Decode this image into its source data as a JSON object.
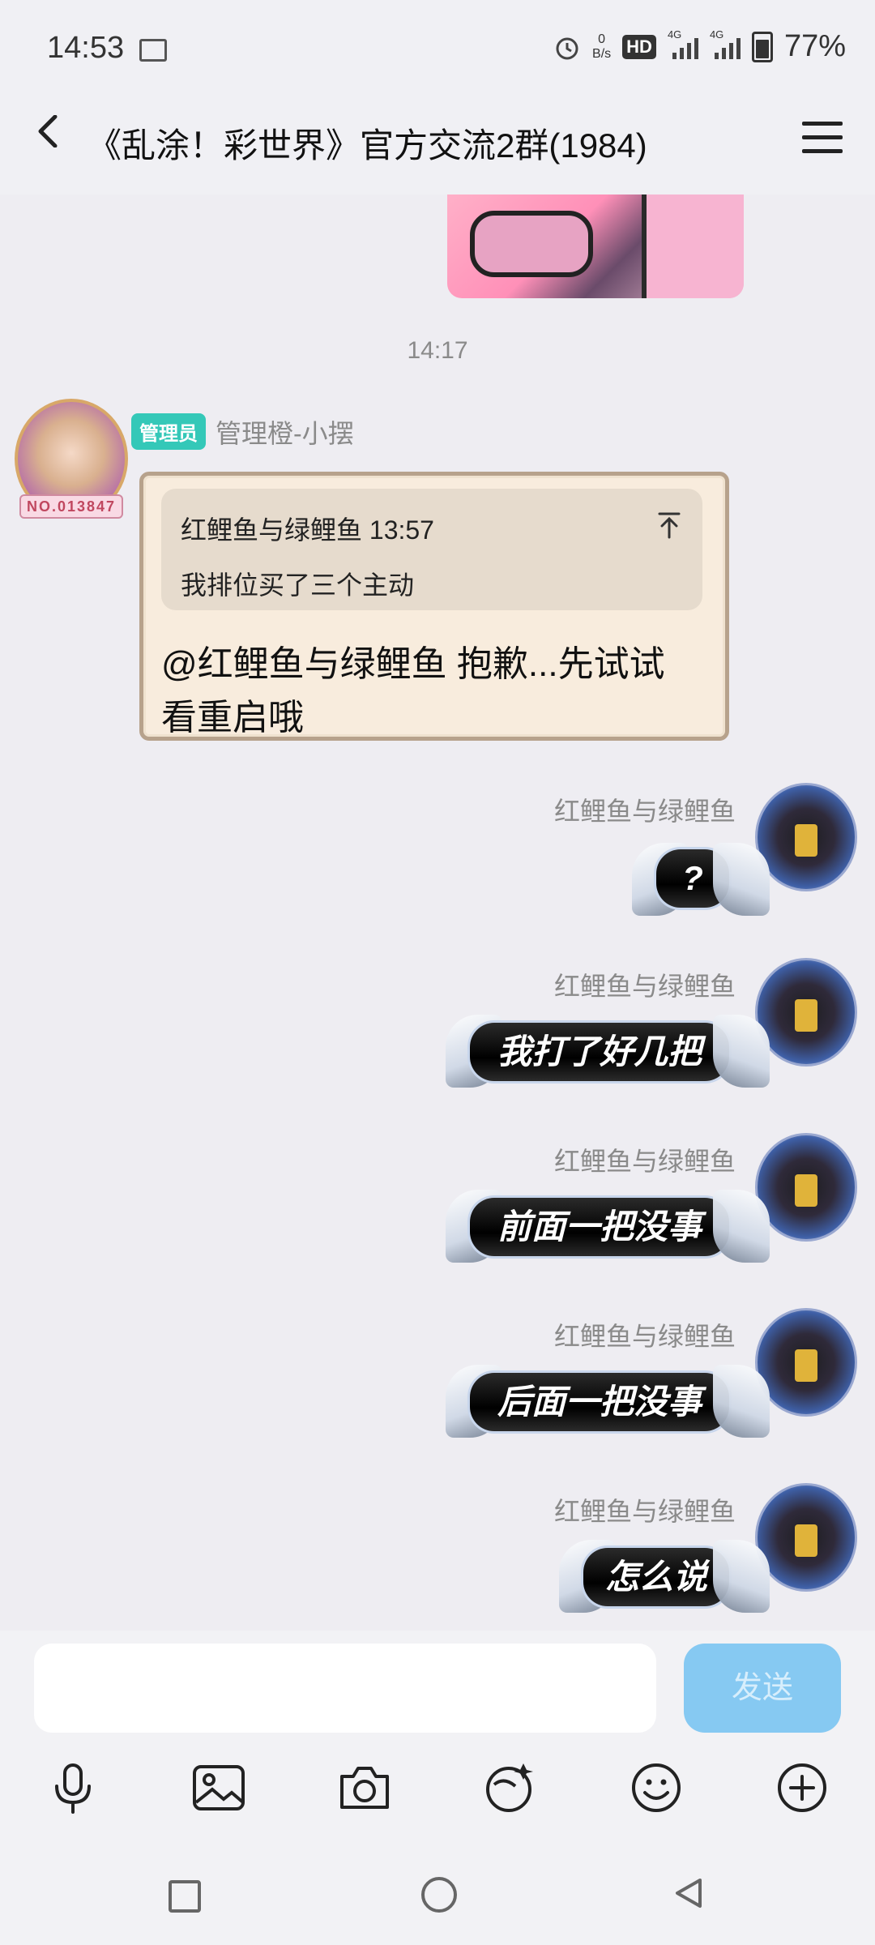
{
  "status_bar": {
    "time": "14:53",
    "net_speed_value": "0",
    "net_speed_unit": "B/s",
    "hd_label": "HD",
    "signal_1_label": "4G",
    "signal_2_label": "4G",
    "battery": "77%"
  },
  "header": {
    "title": "《乱涂！彩世界》官方交流2群(1984)"
  },
  "chat": {
    "timestamp": "14:17",
    "admin_message": {
      "badge": "管理员",
      "sender": "管理橙-小摆",
      "avatar_no": "NO.013847",
      "quote_header": "红鲤鱼与绿鲤鱼 13:57",
      "quote_text": "我排位买了三个主动",
      "body": "@红鲤鱼与绿鲤鱼 抱歉...先试试看重启哦"
    },
    "own_messages": [
      {
        "sender": "红鲤鱼与绿鲤鱼",
        "text": "?"
      },
      {
        "sender": "红鲤鱼与绿鲤鱼",
        "text": "我打了好几把"
      },
      {
        "sender": "红鲤鱼与绿鲤鱼",
        "text": "前面一把没事"
      },
      {
        "sender": "红鲤鱼与绿鲤鱼",
        "text": "后面一把没事"
      },
      {
        "sender": "红鲤鱼与绿鲤鱼",
        "text": "怎么说"
      }
    ]
  },
  "composer": {
    "send_label": "发送"
  },
  "toolbar_icons": [
    "microphone-icon",
    "image-icon",
    "camera-icon",
    "sticker-icon",
    "emoji-icon",
    "plus-icon"
  ],
  "colors": {
    "send_button": "#86c9f2",
    "admin_badge": "#34c8b8",
    "background": "#eeedf2"
  }
}
